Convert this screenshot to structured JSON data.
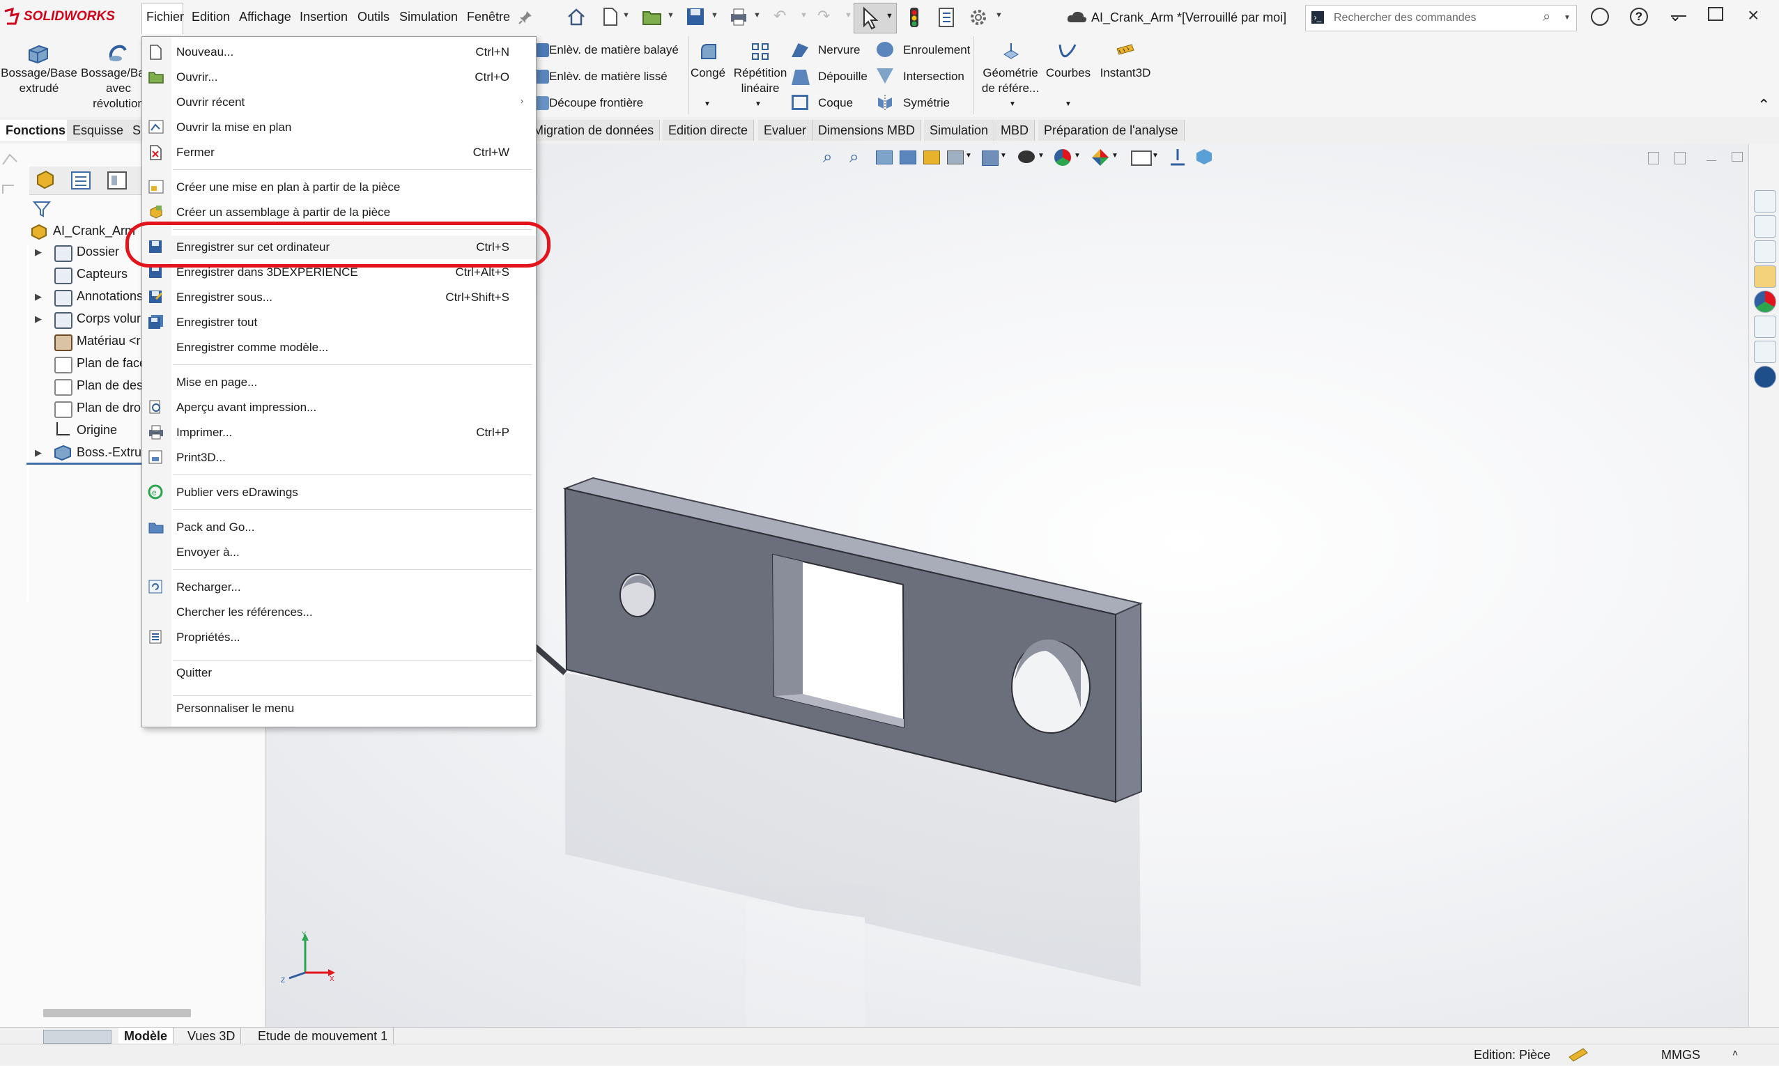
{
  "app": {
    "logo_text": "SOLIDWORKS",
    "document_title": "AI_Crank_Arm *[Verrouillé par moi]",
    "search_placeholder": "Rechercher des commandes"
  },
  "menubar": {
    "items": [
      "Fichier",
      "Edition",
      "Affichage",
      "Insertion",
      "Outils",
      "Simulation",
      "Fenêtre"
    ]
  },
  "ribbon": {
    "boss_extrude": "Bossage/Base extrudé",
    "boss_revolve_1": "Bossage/Base",
    "boss_revolve_2": "avec",
    "boss_revolve_3": "révolution",
    "swept_cut": "Enlèv. de matière balayé",
    "lofted_cut": "Enlèv. de matière lissé",
    "boundary_cut": "Découpe frontière",
    "fillet": "Congé",
    "linear_pattern_1": "Répétition",
    "linear_pattern_2": "linéaire",
    "rib": "Nervure",
    "draft": "Dépouille",
    "shell": "Coque",
    "wrap": "Enroulement",
    "intersect": "Intersection",
    "mirror": "Symétrie",
    "ref_geometry_1": "Géométrie",
    "ref_geometry_2": "de référe...",
    "curves": "Courbes",
    "instant3d": "Instant3D"
  },
  "cm_tabs": [
    "Fonctions",
    "Esquisse",
    "S",
    "Migration de données",
    "Edition directe",
    "Evaluer",
    "Dimensions MBD",
    "Simulation",
    "MBD",
    "Préparation de l'analyse"
  ],
  "tree": {
    "root": "AI_Crank_Arm",
    "items": [
      "Dossier",
      "Capteurs",
      "Annotations",
      "Corps volur",
      "Matériau <r",
      "Plan de face",
      "Plan de des",
      "Plan de dro",
      "Origine",
      "Boss.-Extru..."
    ]
  },
  "file_menu": {
    "items": [
      {
        "label": "Nouveau...",
        "shortcut": "Ctrl+N"
      },
      {
        "label": "Ouvrir...",
        "shortcut": "Ctrl+O"
      },
      {
        "label": "Ouvrir récent",
        "shortcut": ""
      },
      {
        "label": "Ouvrir la mise en plan",
        "shortcut": ""
      },
      {
        "label": "Fermer",
        "shortcut": "Ctrl+W"
      },
      {
        "label": "Créer une mise en plan à partir de la pièce",
        "shortcut": ""
      },
      {
        "label": "Créer un assemblage à partir de la pièce",
        "shortcut": ""
      },
      {
        "label": "Enregistrer sur cet ordinateur",
        "shortcut": "Ctrl+S"
      },
      {
        "label": "Enregistrer dans 3DEXPERIENCE",
        "shortcut": "Ctrl+Alt+S"
      },
      {
        "label": "Enregistrer sous...",
        "shortcut": "Ctrl+Shift+S"
      },
      {
        "label": "Enregistrer tout",
        "shortcut": ""
      },
      {
        "label": "Enregistrer comme modèle...",
        "shortcut": ""
      },
      {
        "label": "Mise en page...",
        "shortcut": ""
      },
      {
        "label": "Aperçu avant impression...",
        "shortcut": ""
      },
      {
        "label": "Imprimer...",
        "shortcut": "Ctrl+P"
      },
      {
        "label": "Print3D...",
        "shortcut": ""
      },
      {
        "label": "Publier vers eDrawings",
        "shortcut": ""
      },
      {
        "label": "Pack and Go...",
        "shortcut": ""
      },
      {
        "label": "Envoyer à...",
        "shortcut": ""
      },
      {
        "label": "Recharger...",
        "shortcut": ""
      },
      {
        "label": "Chercher les références...",
        "shortcut": ""
      },
      {
        "label": "Propriétés...",
        "shortcut": ""
      },
      {
        "label": "Quitter",
        "shortcut": ""
      },
      {
        "label": "Personnaliser le menu",
        "shortcut": ""
      }
    ]
  },
  "bottom_tabs": [
    "Modèle",
    "Vues 3D",
    "Etude de mouvement 1"
  ],
  "status": {
    "mode": "Edition: Pièce",
    "units": "MMGS"
  },
  "colors": {
    "accent_red": "#e3141c",
    "brand_red": "#d0021b",
    "part_gray": "#6b6f7c"
  }
}
